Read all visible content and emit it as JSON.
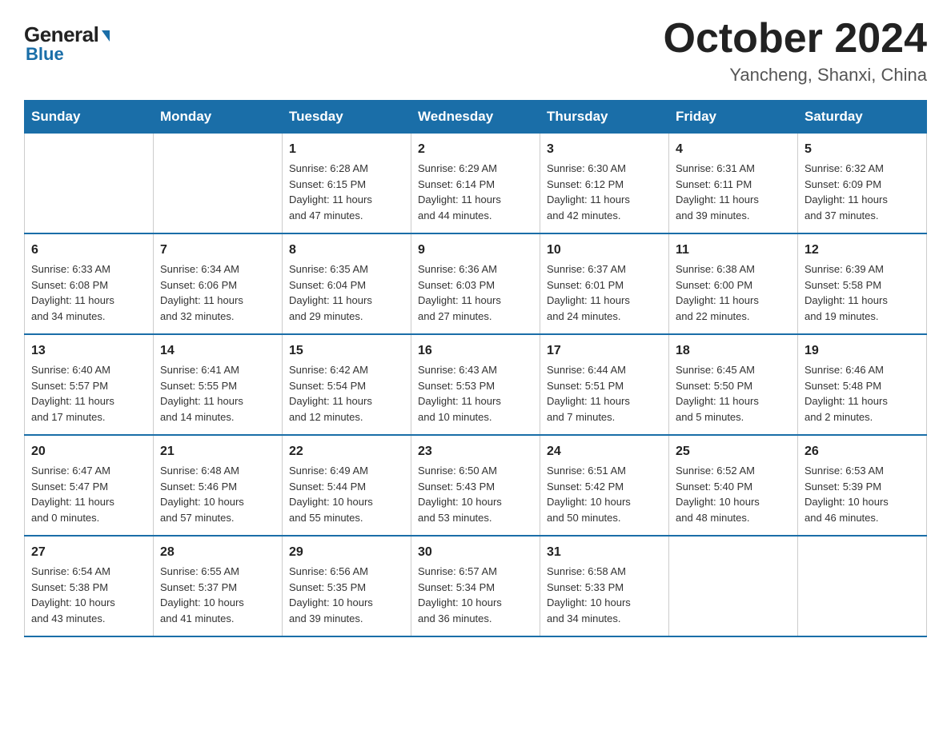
{
  "logo": {
    "general": "General",
    "blue": "Blue"
  },
  "title": {
    "month": "October 2024",
    "location": "Yancheng, Shanxi, China"
  },
  "weekdays": [
    "Sunday",
    "Monday",
    "Tuesday",
    "Wednesday",
    "Thursday",
    "Friday",
    "Saturday"
  ],
  "weeks": [
    [
      {
        "day": "",
        "info": ""
      },
      {
        "day": "",
        "info": ""
      },
      {
        "day": "1",
        "info": "Sunrise: 6:28 AM\nSunset: 6:15 PM\nDaylight: 11 hours\nand 47 minutes."
      },
      {
        "day": "2",
        "info": "Sunrise: 6:29 AM\nSunset: 6:14 PM\nDaylight: 11 hours\nand 44 minutes."
      },
      {
        "day": "3",
        "info": "Sunrise: 6:30 AM\nSunset: 6:12 PM\nDaylight: 11 hours\nand 42 minutes."
      },
      {
        "day": "4",
        "info": "Sunrise: 6:31 AM\nSunset: 6:11 PM\nDaylight: 11 hours\nand 39 minutes."
      },
      {
        "day": "5",
        "info": "Sunrise: 6:32 AM\nSunset: 6:09 PM\nDaylight: 11 hours\nand 37 minutes."
      }
    ],
    [
      {
        "day": "6",
        "info": "Sunrise: 6:33 AM\nSunset: 6:08 PM\nDaylight: 11 hours\nand 34 minutes."
      },
      {
        "day": "7",
        "info": "Sunrise: 6:34 AM\nSunset: 6:06 PM\nDaylight: 11 hours\nand 32 minutes."
      },
      {
        "day": "8",
        "info": "Sunrise: 6:35 AM\nSunset: 6:04 PM\nDaylight: 11 hours\nand 29 minutes."
      },
      {
        "day": "9",
        "info": "Sunrise: 6:36 AM\nSunset: 6:03 PM\nDaylight: 11 hours\nand 27 minutes."
      },
      {
        "day": "10",
        "info": "Sunrise: 6:37 AM\nSunset: 6:01 PM\nDaylight: 11 hours\nand 24 minutes."
      },
      {
        "day": "11",
        "info": "Sunrise: 6:38 AM\nSunset: 6:00 PM\nDaylight: 11 hours\nand 22 minutes."
      },
      {
        "day": "12",
        "info": "Sunrise: 6:39 AM\nSunset: 5:58 PM\nDaylight: 11 hours\nand 19 minutes."
      }
    ],
    [
      {
        "day": "13",
        "info": "Sunrise: 6:40 AM\nSunset: 5:57 PM\nDaylight: 11 hours\nand 17 minutes."
      },
      {
        "day": "14",
        "info": "Sunrise: 6:41 AM\nSunset: 5:55 PM\nDaylight: 11 hours\nand 14 minutes."
      },
      {
        "day": "15",
        "info": "Sunrise: 6:42 AM\nSunset: 5:54 PM\nDaylight: 11 hours\nand 12 minutes."
      },
      {
        "day": "16",
        "info": "Sunrise: 6:43 AM\nSunset: 5:53 PM\nDaylight: 11 hours\nand 10 minutes."
      },
      {
        "day": "17",
        "info": "Sunrise: 6:44 AM\nSunset: 5:51 PM\nDaylight: 11 hours\nand 7 minutes."
      },
      {
        "day": "18",
        "info": "Sunrise: 6:45 AM\nSunset: 5:50 PM\nDaylight: 11 hours\nand 5 minutes."
      },
      {
        "day": "19",
        "info": "Sunrise: 6:46 AM\nSunset: 5:48 PM\nDaylight: 11 hours\nand 2 minutes."
      }
    ],
    [
      {
        "day": "20",
        "info": "Sunrise: 6:47 AM\nSunset: 5:47 PM\nDaylight: 11 hours\nand 0 minutes."
      },
      {
        "day": "21",
        "info": "Sunrise: 6:48 AM\nSunset: 5:46 PM\nDaylight: 10 hours\nand 57 minutes."
      },
      {
        "day": "22",
        "info": "Sunrise: 6:49 AM\nSunset: 5:44 PM\nDaylight: 10 hours\nand 55 minutes."
      },
      {
        "day": "23",
        "info": "Sunrise: 6:50 AM\nSunset: 5:43 PM\nDaylight: 10 hours\nand 53 minutes."
      },
      {
        "day": "24",
        "info": "Sunrise: 6:51 AM\nSunset: 5:42 PM\nDaylight: 10 hours\nand 50 minutes."
      },
      {
        "day": "25",
        "info": "Sunrise: 6:52 AM\nSunset: 5:40 PM\nDaylight: 10 hours\nand 48 minutes."
      },
      {
        "day": "26",
        "info": "Sunrise: 6:53 AM\nSunset: 5:39 PM\nDaylight: 10 hours\nand 46 minutes."
      }
    ],
    [
      {
        "day": "27",
        "info": "Sunrise: 6:54 AM\nSunset: 5:38 PM\nDaylight: 10 hours\nand 43 minutes."
      },
      {
        "day": "28",
        "info": "Sunrise: 6:55 AM\nSunset: 5:37 PM\nDaylight: 10 hours\nand 41 minutes."
      },
      {
        "day": "29",
        "info": "Sunrise: 6:56 AM\nSunset: 5:35 PM\nDaylight: 10 hours\nand 39 minutes."
      },
      {
        "day": "30",
        "info": "Sunrise: 6:57 AM\nSunset: 5:34 PM\nDaylight: 10 hours\nand 36 minutes."
      },
      {
        "day": "31",
        "info": "Sunrise: 6:58 AM\nSunset: 5:33 PM\nDaylight: 10 hours\nand 34 minutes."
      },
      {
        "day": "",
        "info": ""
      },
      {
        "day": "",
        "info": ""
      }
    ]
  ]
}
